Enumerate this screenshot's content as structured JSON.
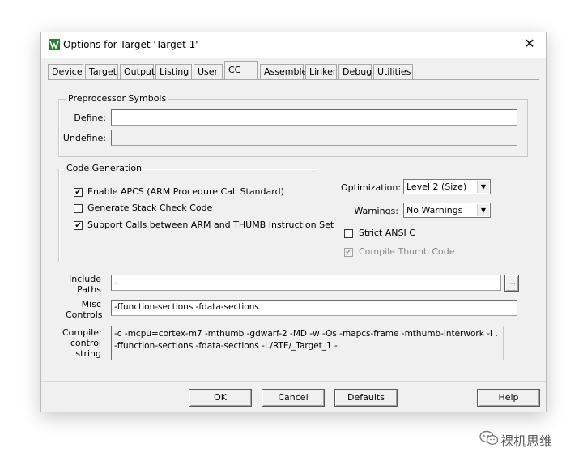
{
  "window": {
    "title": "Options for Target 'Target 1'",
    "close_glyph": "✕"
  },
  "tabs": [
    {
      "label": "Device"
    },
    {
      "label": "Target"
    },
    {
      "label": "Output"
    },
    {
      "label": "Listing"
    },
    {
      "label": "User"
    },
    {
      "label": "CC"
    },
    {
      "label": "Assembler"
    },
    {
      "label": "Linker"
    },
    {
      "label": "Debug"
    },
    {
      "label": "Utilities"
    }
  ],
  "active_tab": "CC",
  "preprocessor": {
    "title": "Preprocessor Symbols",
    "define_label": "Define:",
    "define_value": "",
    "undefine_label": "Undefine:",
    "undefine_value": ""
  },
  "code_generation": {
    "title": "Code Generation",
    "apcs": {
      "label": "Enable APCS (ARM Procedure Call Standard)",
      "checked": true
    },
    "stack_check": {
      "label": "Generate Stack Check Code",
      "checked": false
    },
    "interwork": {
      "label": "Support Calls between ARM and THUMB Instruction Set",
      "checked": true
    }
  },
  "options": {
    "optimization_label": "Optimization:",
    "optimization_value": "Level 2 (Size)",
    "warnings_label": "Warnings:",
    "warnings_value": "No Warnings",
    "strict_ansi": {
      "label": "Strict ANSI C",
      "checked": false
    },
    "thumb_code": {
      "label": "Compile Thumb Code",
      "checked": true,
      "disabled": true
    }
  },
  "include_paths": {
    "label_line1": "Include",
    "label_line2": "Paths",
    "value": ".",
    "browse_label": "..."
  },
  "misc_controls": {
    "label_line1": "Misc",
    "label_line2": "Controls",
    "value": "-ffunction-sections -fdata-sections"
  },
  "compiler_string": {
    "label_line1": "Compiler",
    "label_line2": "control",
    "label_line3": "string",
    "value": "-c -mcpu=cortex-m7 -mthumb -gdwarf-2 -MD -w -Os -mapcs-frame -mthumb-interwork -I . -ffunction-sections -fdata-sections -I./RTE/_Target_1 -"
  },
  "buttons": {
    "ok": "OK",
    "cancel": "Cancel",
    "defaults": "Defaults",
    "help": "Help"
  },
  "watermark": {
    "text": "裸机思维",
    "icon": "wechat-icon"
  },
  "check_glyph": "✔"
}
